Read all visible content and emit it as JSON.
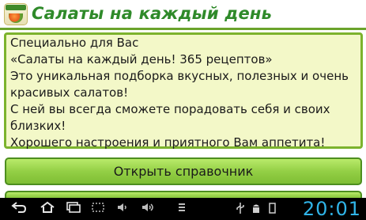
{
  "app": {
    "title": "Салаты на каждый день"
  },
  "intro": {
    "lines": [
      "Специально для Вас",
      "«Салаты на каждый день! 365 рецептов»",
      "Это уникальная подборка вкусных, полезных и очень",
      "красивых салатов!",
      "С ней вы всегда сможете порадовать себя и своих",
      "близких!",
      "Хорошего настроения и приятного Вам аппетита!"
    ]
  },
  "buttons": {
    "open_guide": "Открыть справочник",
    "second": ""
  },
  "system_bar": {
    "time": "20:01",
    "icons": [
      "back-icon",
      "home-icon",
      "recent-apps-icon",
      "screenshot-icon",
      "volume-down-icon",
      "volume-up-icon",
      "menu-icon",
      "usb-icon",
      "android-debug-icon",
      "storage-icon"
    ]
  },
  "colors": {
    "accent_green": "#7cb32d",
    "title_green": "#2f8a2a",
    "panel_bg": "#f3f8c8",
    "clock_blue": "#30b4e8"
  }
}
